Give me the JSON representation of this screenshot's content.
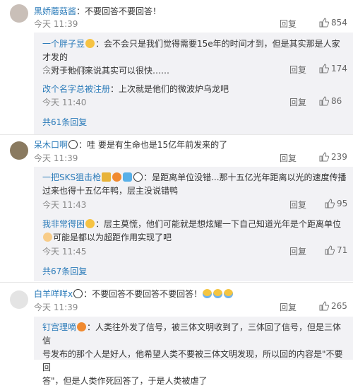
{
  "comments": [
    {
      "user": "黑娇蘑菇酱",
      "text": "：不要回答不要回答！",
      "time": "今天 11:39",
      "reply": "回复",
      "likes": "854"
    },
    {
      "user": "呆木口啊",
      "text": "：哇 要是有生命也是15亿年前发来的了",
      "time": "今天 11:39",
      "reply": "回复",
      "likes": "239"
    },
    {
      "user": "白羊咩咩x",
      "text": "：不要回答不要回答不要回答！",
      "time": "今天 11:39",
      "reply": "回复",
      "likes": "265"
    }
  ],
  "replies_a": [
    {
      "user": "一个胖子昱",
      "line1": "：会不会只是我们觉得需要15e年的时间才到，但是其实那是人家才发的",
      "line2": "…对于他们来说其实可以很快……",
      "time": "今天 11:48",
      "reply": "回复",
      "likes": "174"
    },
    {
      "user": "改个名字总被注册",
      "line1": "：上次就是他们的微波炉乌龙吧",
      "time": "今天 11:40",
      "reply": "回复",
      "likes": "86"
    }
  ],
  "more_a": "共61条回复",
  "replies_b": [
    {
      "user": "一把SKS狙击枪",
      "line1": "：是距离单位没错...那十五亿光年距离以光的速度传播",
      "line2": "过来也得十五亿年鸭，层主没说错鸭",
      "time": "今天 11:43",
      "reply": "回复",
      "likes": "95"
    },
    {
      "user": "我非常得困",
      "line1": "：层主莫慌，他们可能就是想炫耀一下自己知道光年是个距离单位",
      "line2": "可能是都以为超距作用实现了吧",
      "time": "今天 11:45",
      "reply": "回复",
      "likes": "71"
    }
  ],
  "more_b": "共67条回复",
  "reply_c": {
    "user": "钉宫理嘀",
    "line1": "：人类往外发了信号，被三体文明收到了，三体回了信号，但是三体信",
    "line2": "号发布的那个人是好人，他希望人类不要被三体文明发现，所以回的内容是\"不要回",
    "line3": "答\"，但是人类作死回答了，于是人类被虐了"
  }
}
